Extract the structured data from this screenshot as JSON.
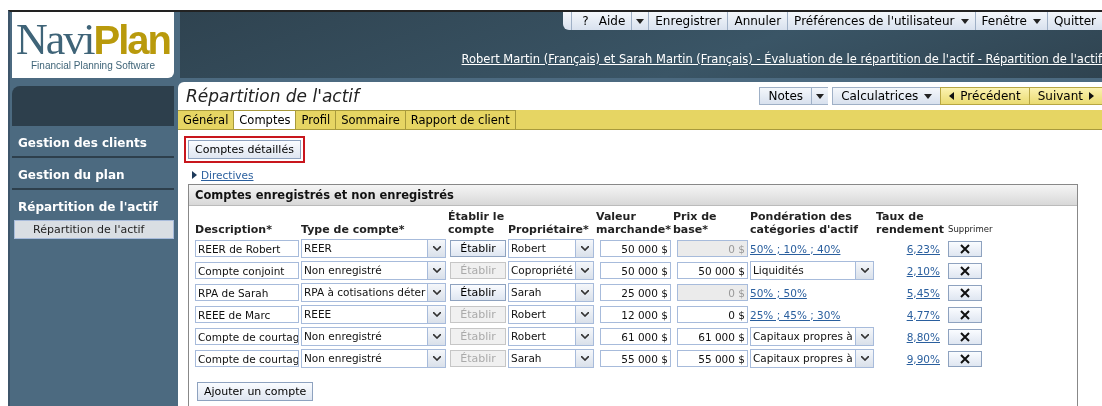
{
  "logo": {
    "word_1": "Navi",
    "word_2": "Plan",
    "tagline": "Financial Planning Software"
  },
  "top_menu": [
    {
      "label": "Aide",
      "kind": "help_split",
      "icon_text": "?"
    },
    {
      "label": "Enregistrer",
      "kind": "plain"
    },
    {
      "label": "Annuler",
      "kind": "plain"
    },
    {
      "label": "Préférences de l'utilisateur",
      "kind": "menu"
    },
    {
      "label": "Fenêtre",
      "kind": "menu"
    },
    {
      "label": "Quitter",
      "kind": "plain"
    }
  ],
  "breadcrumb": "Robert Martin (Français) et Sarah Martin (Français) - Évaluation de le répartition de l'actif - Répartition de l'actif",
  "sidebar": {
    "items": [
      {
        "label": "Gestion des clients",
        "expanded": false
      },
      {
        "label": "Gestion du plan",
        "expanded": false
      },
      {
        "label": "Répartition de l'actif",
        "expanded": true,
        "children": [
          {
            "label": "Répartition de l'actif",
            "selected": true
          }
        ]
      }
    ]
  },
  "page_title": "Répartition de l'actif",
  "toolbar": [
    {
      "label": "Notes",
      "kind": "split"
    },
    {
      "label": "Calculatrices",
      "kind": "menu"
    },
    {
      "label": "Précédent",
      "kind": "prev"
    },
    {
      "label": "Suivant",
      "kind": "next"
    }
  ],
  "tabs": [
    {
      "label": "Général",
      "selected": false
    },
    {
      "label": "Comptes",
      "selected": true
    },
    {
      "label": "Profil",
      "selected": false
    },
    {
      "label": "Sommaire",
      "selected": false
    },
    {
      "label": "Rapport de client",
      "selected": false
    }
  ],
  "detail_button": {
    "label": "Comptes détaillés",
    "highlighted": true
  },
  "directives": {
    "label": "Directives",
    "expanded": false
  },
  "panel": {
    "title": "Comptes enregistrés et non enregistrés",
    "columns": [
      "Description*",
      "Type de compte*",
      "Établir le compte",
      "Propriétaire*",
      "Valeur marchande*",
      "Prix de base*",
      "Pondération des catégories d'actif",
      "Taux de rendement",
      "Supprimer"
    ],
    "rows": [
      {
        "description": "REER de Robert",
        "account_type": "REER",
        "establish": {
          "label": "Établir",
          "disabled": false
        },
        "owner": "Robert",
        "market_value": "50 000 $",
        "base_price": {
          "value": "0 $",
          "disabled": true
        },
        "weighting": {
          "kind": "link",
          "text": "50% ; 10% ; 40%"
        },
        "rate": "6,23%"
      },
      {
        "description": "Compte conjoint",
        "account_type": "Non enregistré",
        "establish": {
          "label": "Établir",
          "disabled": true
        },
        "owner": "Copropriété",
        "market_value": "50 000 $",
        "base_price": {
          "value": "50 000 $",
          "disabled": false
        },
        "weighting": {
          "kind": "select",
          "text": "Liquidités"
        },
        "rate": "2,10%"
      },
      {
        "description": "RPA de Sarah",
        "account_type": "RPA à cotisations déter",
        "establish": {
          "label": "Établir",
          "disabled": false
        },
        "owner": "Sarah",
        "market_value": "25 000 $",
        "base_price": {
          "value": "0 $",
          "disabled": true
        },
        "weighting": {
          "kind": "link",
          "text": "50% ; 50%"
        },
        "rate": "5,45%"
      },
      {
        "description": "REEE de Marc",
        "account_type": "REEE",
        "establish": {
          "label": "Établir",
          "disabled": true
        },
        "owner": "Robert",
        "market_value": "12 000 $",
        "base_price": {
          "value": "0 $",
          "disabled": false
        },
        "weighting": {
          "kind": "link",
          "text": "25% ; 45% ; 30%"
        },
        "rate": "4,77%"
      },
      {
        "description": "Compte de courtag",
        "account_type": "Non enregistré",
        "establish": {
          "label": "Établir",
          "disabled": true
        },
        "owner": "Robert",
        "market_value": "61 000 $",
        "base_price": {
          "value": "61 000 $",
          "disabled": false
        },
        "weighting": {
          "kind": "select",
          "text": "Capitaux propres à"
        },
        "rate": "8,80%"
      },
      {
        "description": "Compte de courtag",
        "account_type": "Non enregistré",
        "establish": {
          "label": "Établir",
          "disabled": true
        },
        "owner": "Sarah",
        "market_value": "55 000 $",
        "base_price": {
          "value": "55 000 $",
          "disabled": false
        },
        "weighting": {
          "kind": "select",
          "text": "Capitaux propres à"
        },
        "rate": "9,90%"
      }
    ],
    "add_button": "Ajouter un compte"
  }
}
